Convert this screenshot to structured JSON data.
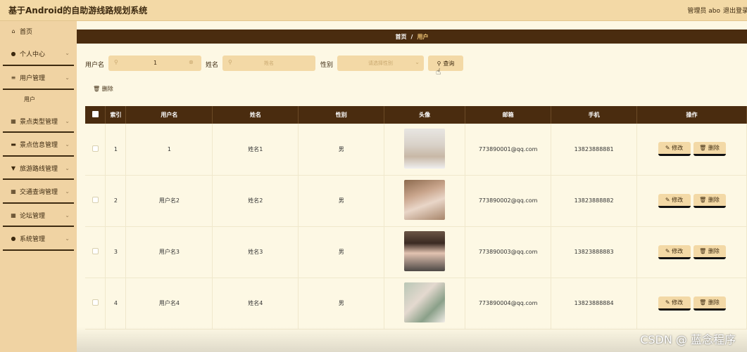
{
  "app": {
    "title": "基于Android的自助游线路规划系统",
    "admin": "管理员 abo",
    "logout": "退出登录"
  },
  "sidebar": {
    "items": [
      {
        "label": "首页",
        "icon": "home-icon"
      },
      {
        "label": "个人中心",
        "icon": "user-icon"
      },
      {
        "label": "用户管理",
        "icon": "list-icon"
      },
      {
        "label": "用户"
      },
      {
        "label": "景点类型管理",
        "icon": "grid-icon"
      },
      {
        "label": "景点信息管理",
        "icon": "card-icon"
      },
      {
        "label": "旅游路线管理",
        "icon": "pin-icon"
      },
      {
        "label": "交通查询管理",
        "icon": "grid-icon"
      },
      {
        "label": "论坛管理",
        "icon": "grid-icon"
      },
      {
        "label": "系统管理",
        "icon": "user-icon"
      }
    ]
  },
  "breadcrumb": {
    "home": "首页",
    "sep": "/",
    "current": "用户"
  },
  "search": {
    "username_label": "用户名",
    "username_value": "1",
    "name_label": "姓名",
    "name_placeholder": "姓名",
    "gender_label": "性别",
    "gender_placeholder": "请选择性别",
    "button": "查询"
  },
  "actions": {
    "delete": "删除"
  },
  "table": {
    "headers": [
      "索引",
      "用户名",
      "姓名",
      "性别",
      "头像",
      "邮箱",
      "手机",
      "操作"
    ],
    "rows": [
      {
        "index": "1",
        "username": "1",
        "name": "姓名1",
        "gender": "男",
        "email": "773890001@qq.com",
        "phone": "13823888881"
      },
      {
        "index": "2",
        "username": "用户名2",
        "name": "姓名2",
        "gender": "男",
        "email": "773890002@qq.com",
        "phone": "13823888882"
      },
      {
        "index": "3",
        "username": "用户名3",
        "name": "姓名3",
        "gender": "男",
        "email": "773890003@qq.com",
        "phone": "13823888883"
      },
      {
        "index": "4",
        "username": "用户名4",
        "name": "姓名4",
        "gender": "男",
        "email": "773890004@qq.com",
        "phone": "13823888884"
      }
    ],
    "edit_label": "修改",
    "delete_label": "删除"
  },
  "watermark": "CSDN @ 蓝念程序",
  "colors": {
    "primary": "#4a2c0f",
    "accent": "#f3d9a6",
    "background": "#fdf8e4"
  }
}
